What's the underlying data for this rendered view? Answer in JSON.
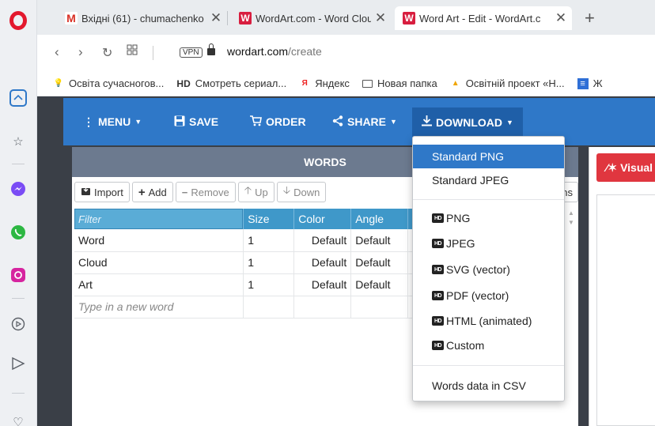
{
  "browser": {
    "tabs": [
      {
        "title": "Вхідні (61) - chumachenko",
        "favicon": "gmail-icon"
      },
      {
        "title": "WordArt.com - Word Cloud",
        "favicon": "wordart-icon"
      },
      {
        "title": "Word Art - Edit - WordArt.c",
        "favicon": "wordart-icon",
        "active": true
      }
    ],
    "vpn_label": "VPN",
    "url_domain": "wordart.com",
    "url_path": "/create",
    "bookmarks": [
      {
        "label": "Освіта сучасногов...",
        "icon": "bulb-icon"
      },
      {
        "label": "Смотреть сериал...",
        "icon": "hd-icon",
        "prefix": "HD"
      },
      {
        "label": "Яндекс",
        "icon": "yandex-icon",
        "prefix": "Я"
      },
      {
        "label": "Новая папка",
        "icon": "folder-icon"
      },
      {
        "label": "Освітній проект «Н...",
        "icon": "cone-icon"
      },
      {
        "label": "Ж",
        "icon": "doc-icon"
      }
    ]
  },
  "toolbar": {
    "menu": "MENU",
    "save": "SAVE",
    "order": "ORDER",
    "share": "SHARE",
    "download": "DOWNLOAD"
  },
  "words": {
    "header": "WORDS",
    "buttons": {
      "import": "Import",
      "add": "Add",
      "remove": "Remove",
      "up": "Up",
      "down": "Down",
      "options_fragment": "ns"
    },
    "columns": {
      "filter_placeholder": "Filter",
      "size": "Size",
      "color": "Color",
      "angle": "Angle"
    },
    "rows": [
      {
        "word": "Word",
        "size": "1",
        "color": "Default",
        "angle": "Default"
      },
      {
        "word": "Cloud",
        "size": "1",
        "color": "Default",
        "angle": "Default"
      },
      {
        "word": "Art",
        "size": "1",
        "color": "Default",
        "angle": "Default"
      }
    ],
    "new_word_placeholder": "Type in a new word"
  },
  "visualize_label": "Visual",
  "download_menu": {
    "standard": [
      "Standard PNG",
      "Standard JPEG"
    ],
    "hd_badge": "HD",
    "hd": [
      "PNG",
      "JPEG",
      "SVG (vector)",
      "PDF (vector)",
      "HTML (animated)",
      "Custom"
    ],
    "csv": "Words data in CSV"
  },
  "colors": {
    "toolbar": "#2f78c8",
    "words_header": "#6c7a8f",
    "table_header": "#3f98c9",
    "visualize": "#e0363f",
    "highlight": "#2f78c8"
  }
}
